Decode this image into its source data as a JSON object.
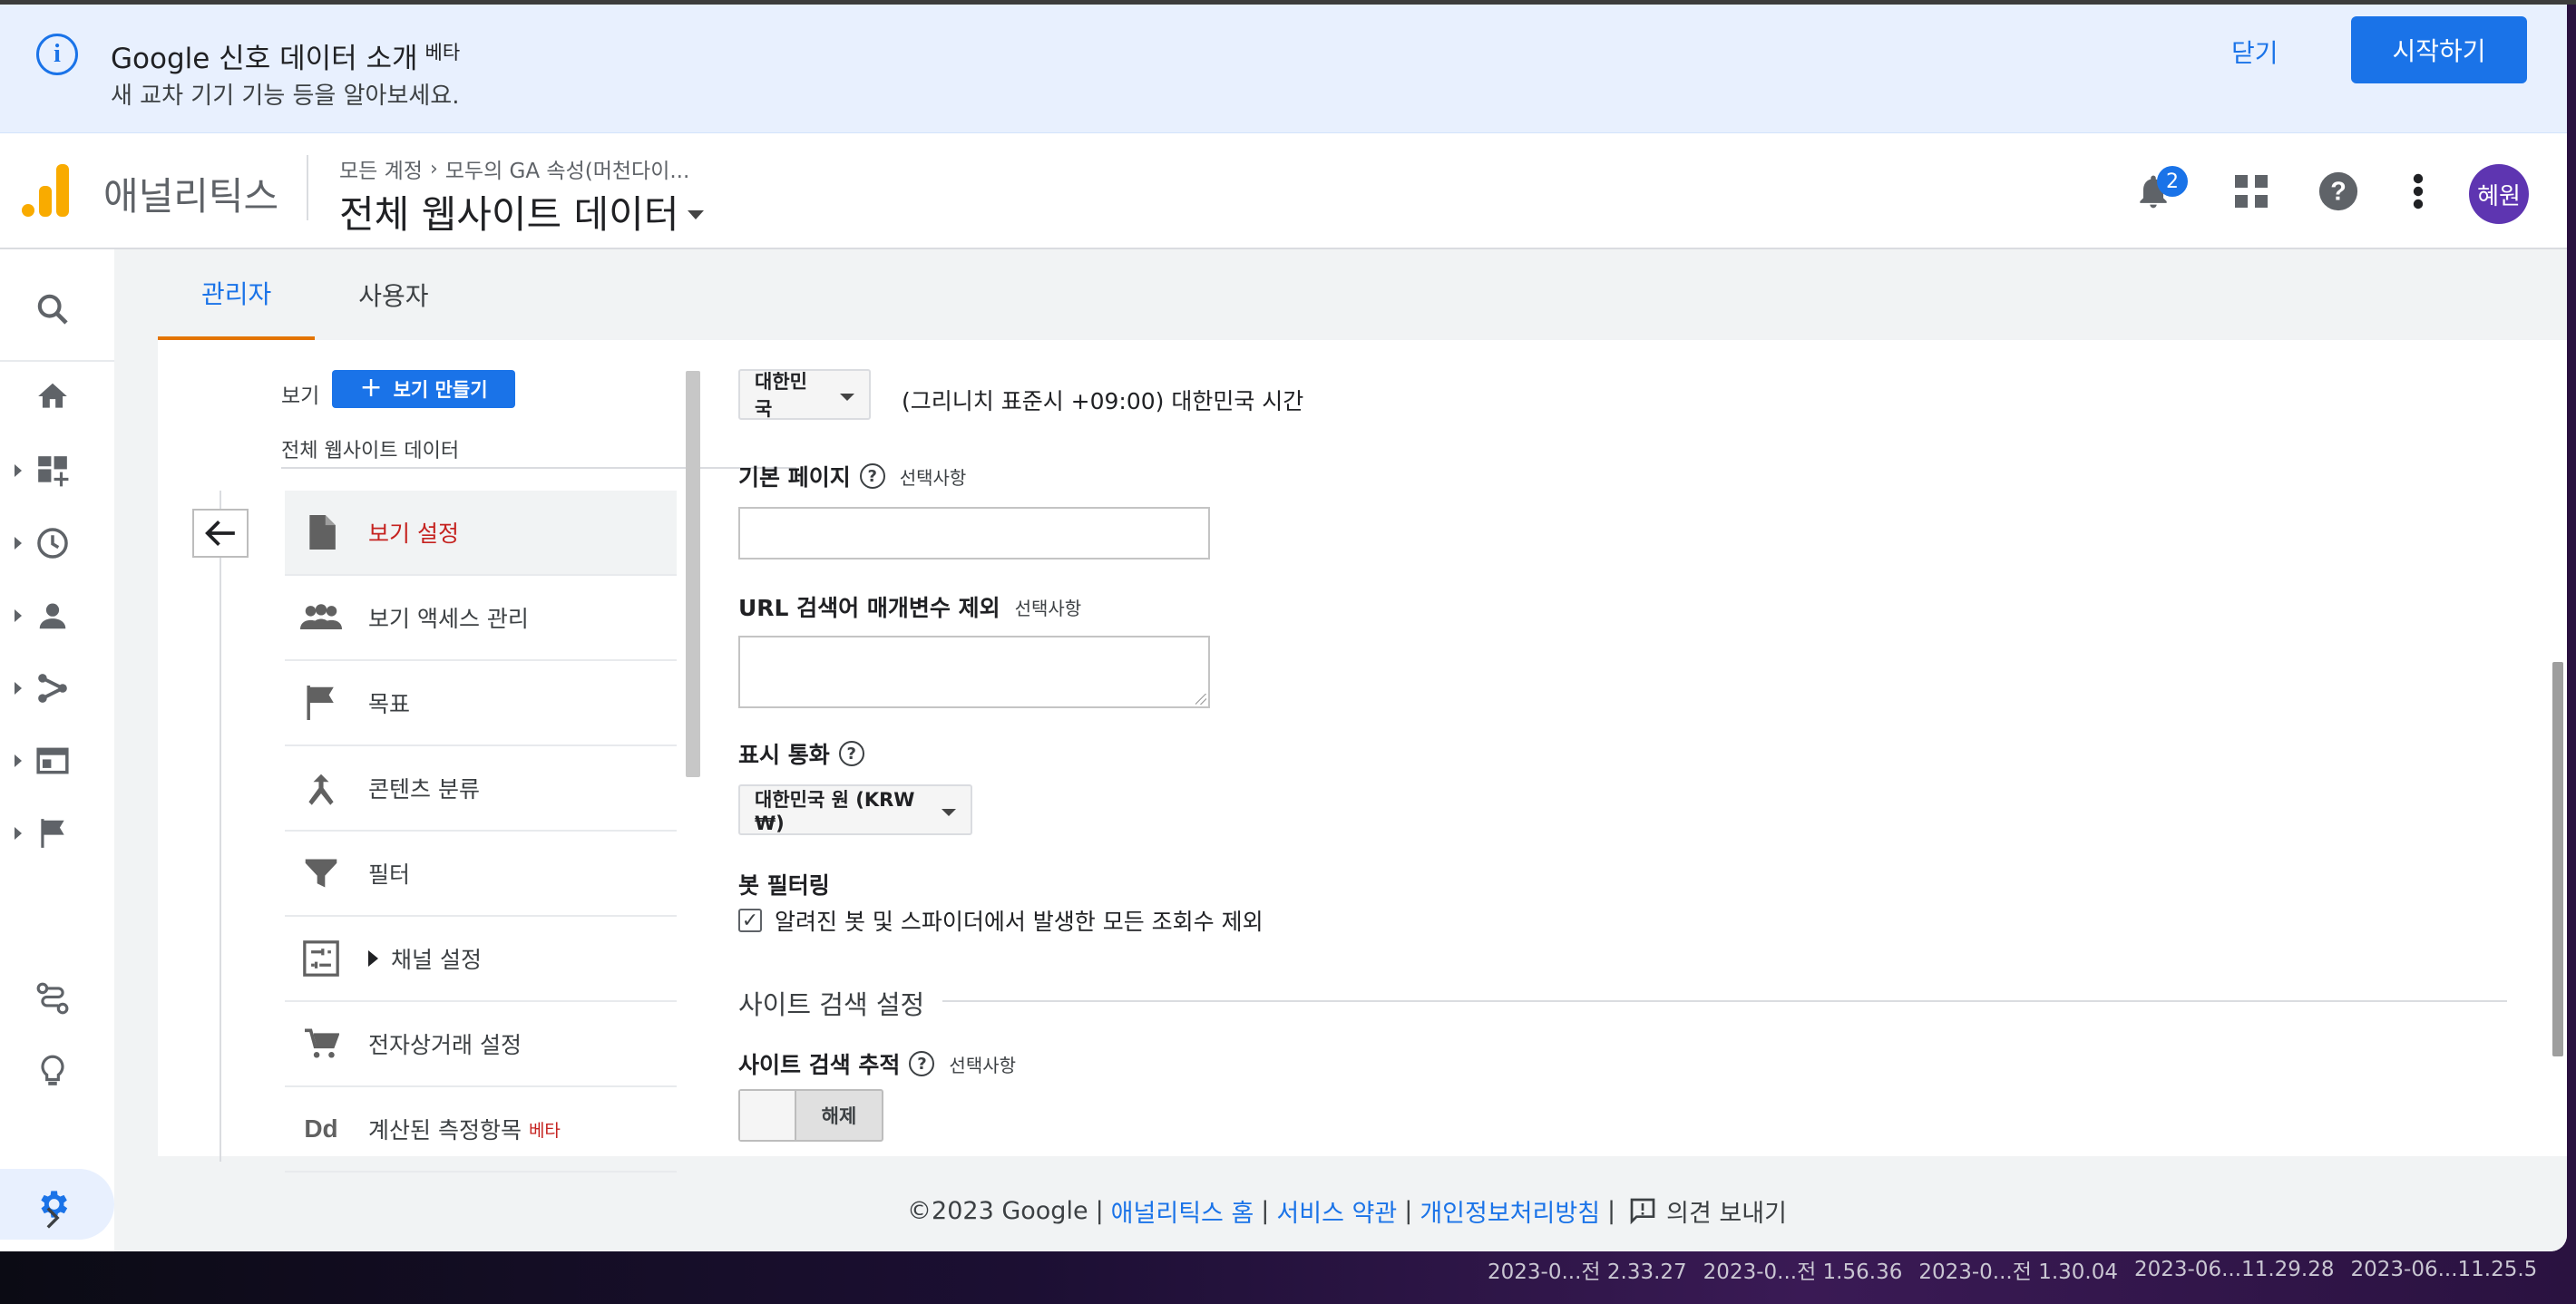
{
  "banner": {
    "title": "Google 신호 데이터 소개",
    "beta": "베타",
    "subtitle": "새 교차 기기 기능 등을 알아보세요.",
    "close_label": "닫기",
    "start_label": "시작하기"
  },
  "header": {
    "app_name": "애널리틱스",
    "breadcrumb_account": "모든 계정",
    "breadcrumb_property": "모두의 GA 속성(머천다이...",
    "view_title": "전체 웹사이트 데이터",
    "notification_count": "2",
    "avatar_text": "혜원"
  },
  "tabs": [
    {
      "label": "관리자",
      "active": true
    },
    {
      "label": "사용자",
      "active": false
    }
  ],
  "view_panel": {
    "view_label": "보기",
    "make_view_label": "보기 만들기",
    "view_name": "전체 웹사이트 데이터",
    "menu": [
      {
        "label": "보기 설정",
        "icon": "document-icon",
        "selected": true
      },
      {
        "label": "보기 액세스 관리",
        "icon": "people-icon"
      },
      {
        "label": "목표",
        "icon": "flag-icon"
      },
      {
        "label": "콘텐츠 분류",
        "icon": "merge-icon"
      },
      {
        "label": "필터",
        "icon": "filter-icon"
      },
      {
        "label": "채널 설정",
        "icon": "channel-icon"
      },
      {
        "label": "전자상거래 설정",
        "icon": "cart-icon"
      },
      {
        "label": "계산된 측정항목",
        "icon": "dd-icon",
        "beta": "베타"
      }
    ]
  },
  "settings": {
    "country": "대한민국",
    "timezone": "(그리니치 표준시 +09:00) 대한민국 시간",
    "default_page_label": "기본 페이지",
    "optional": "선택사항",
    "default_page_value": "",
    "url_exclude_label": "URL 검색어 매개변수 제외",
    "url_exclude_value": "",
    "currency_label": "표시 통화",
    "currency_value": "대한민국 원 (KRW ₩)",
    "bot_label": "봇 필터링",
    "bot_checkbox_label": "알려진 봇 및 스파이더에서 발생한 모든 조회수 제외",
    "bot_checked": true,
    "site_search_section": "사이트 검색 설정",
    "site_search_tracking_label": "사이트 검색 추적",
    "toggle_label": "해제"
  },
  "footer": {
    "copyright": "©2023 Google",
    "links": [
      "애널리틱스 홈",
      "서비스 약관",
      "개인정보처리방침"
    ],
    "feedback": "의견 보내기"
  },
  "desktop": {
    "files": [
      "2023-0...전 2.33.27",
      "2023-0...전 1.56.36",
      "2023-0...전 1.30.04",
      "2023-06...11.29.28",
      "2023-06...11.25.5"
    ]
  },
  "colors": {
    "accent": "#1a73e8",
    "logo": "#f9ab00",
    "selected_text": "#c5221f",
    "tab_underline": "#e37400",
    "avatar": "#5e35b1"
  }
}
